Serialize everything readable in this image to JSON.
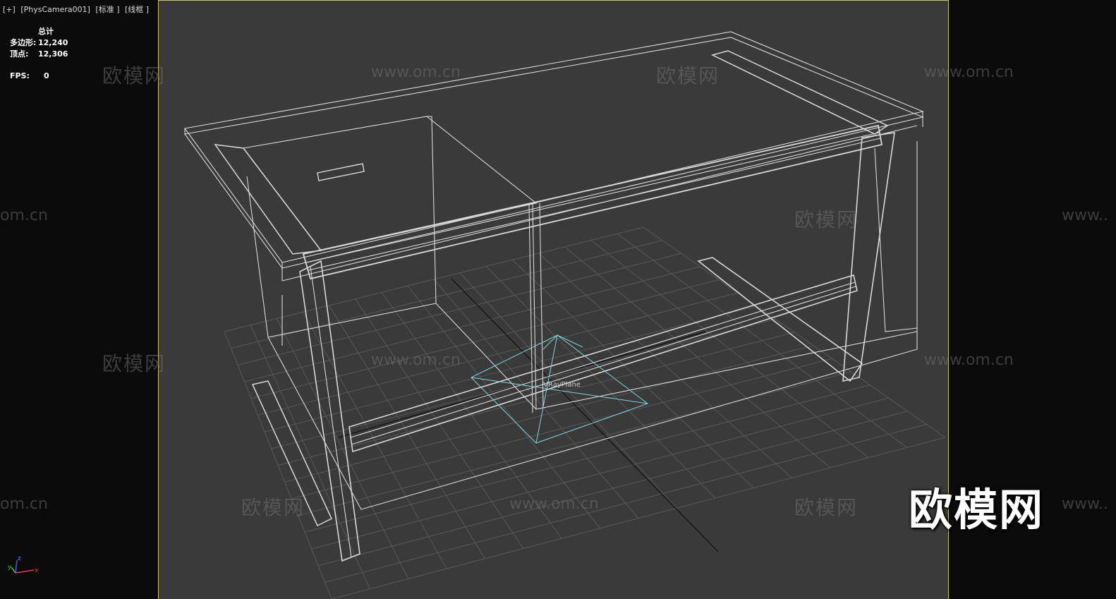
{
  "viewport": {
    "labels": [
      "[+]",
      "[PhysCamera001]",
      "[标准 ]",
      "[线框 ]"
    ]
  },
  "stats": {
    "header": "总计",
    "polygons_label": "多边形:",
    "polygons_value": "12,240",
    "vertices_label": "顶点:",
    "vertices_value": "12,306",
    "fps_label": "FPS:",
    "fps_value": "0"
  },
  "scene": {
    "object_label": "VRayPlane",
    "frame_color": "#c8c84a",
    "wire_color": "#d9d9d9",
    "grid_color": "#5a5a5a",
    "helper_color": "#7fd4d4"
  },
  "watermarks": {
    "brand_cn": "欧模网",
    "brand_url": "www.om.cn",
    "url_cut": "om.cn",
    "url_prefix": "www.."
  },
  "logo": "欧模网",
  "gizmo": {
    "x": "x",
    "y": "y",
    "z": "z"
  }
}
